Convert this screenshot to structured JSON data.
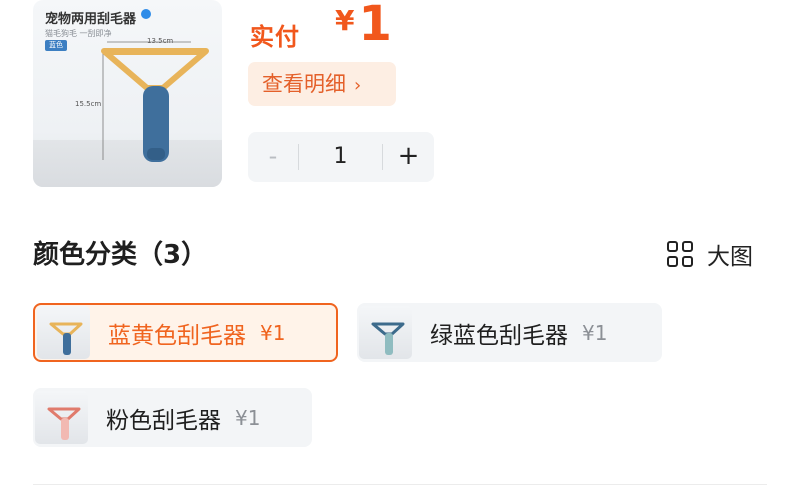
{
  "product": {
    "title": "宠物两用刮毛器",
    "subtitle": "猫毛狗毛 一刮即净",
    "color_chip": "蓝色",
    "width_label": "13.5cm",
    "height_label": "15.5cm"
  },
  "price": {
    "label": "实付",
    "currency": "¥",
    "amount": "1"
  },
  "detail_button": {
    "label": "查看明细",
    "chevron": "›"
  },
  "quantity": {
    "minus": "-",
    "value": "1",
    "plus": "+"
  },
  "section": {
    "title": "颜色分类（3）",
    "big_view_label": "大图",
    "big_view_icon": "grid-icon"
  },
  "options": [
    {
      "name": "蓝黄色刮毛器",
      "price": "¥1",
      "selected": true,
      "colors": {
        "handle": "#3f6f9c",
        "blade": "#e8b45a"
      }
    },
    {
      "name": "绿蓝色刮毛器",
      "price": "¥1",
      "selected": false,
      "colors": {
        "handle": "#8fbcc0",
        "blade": "#3d6b8c"
      }
    },
    {
      "name": "粉色刮毛器",
      "price": "¥1",
      "selected": false,
      "colors": {
        "handle": "#f2b9b2",
        "blade": "#e07b6c"
      }
    }
  ],
  "theme": {
    "accent": "#f1571c",
    "accent_soft": "#fdeee3",
    "card_bg": "#f3f5f7"
  }
}
